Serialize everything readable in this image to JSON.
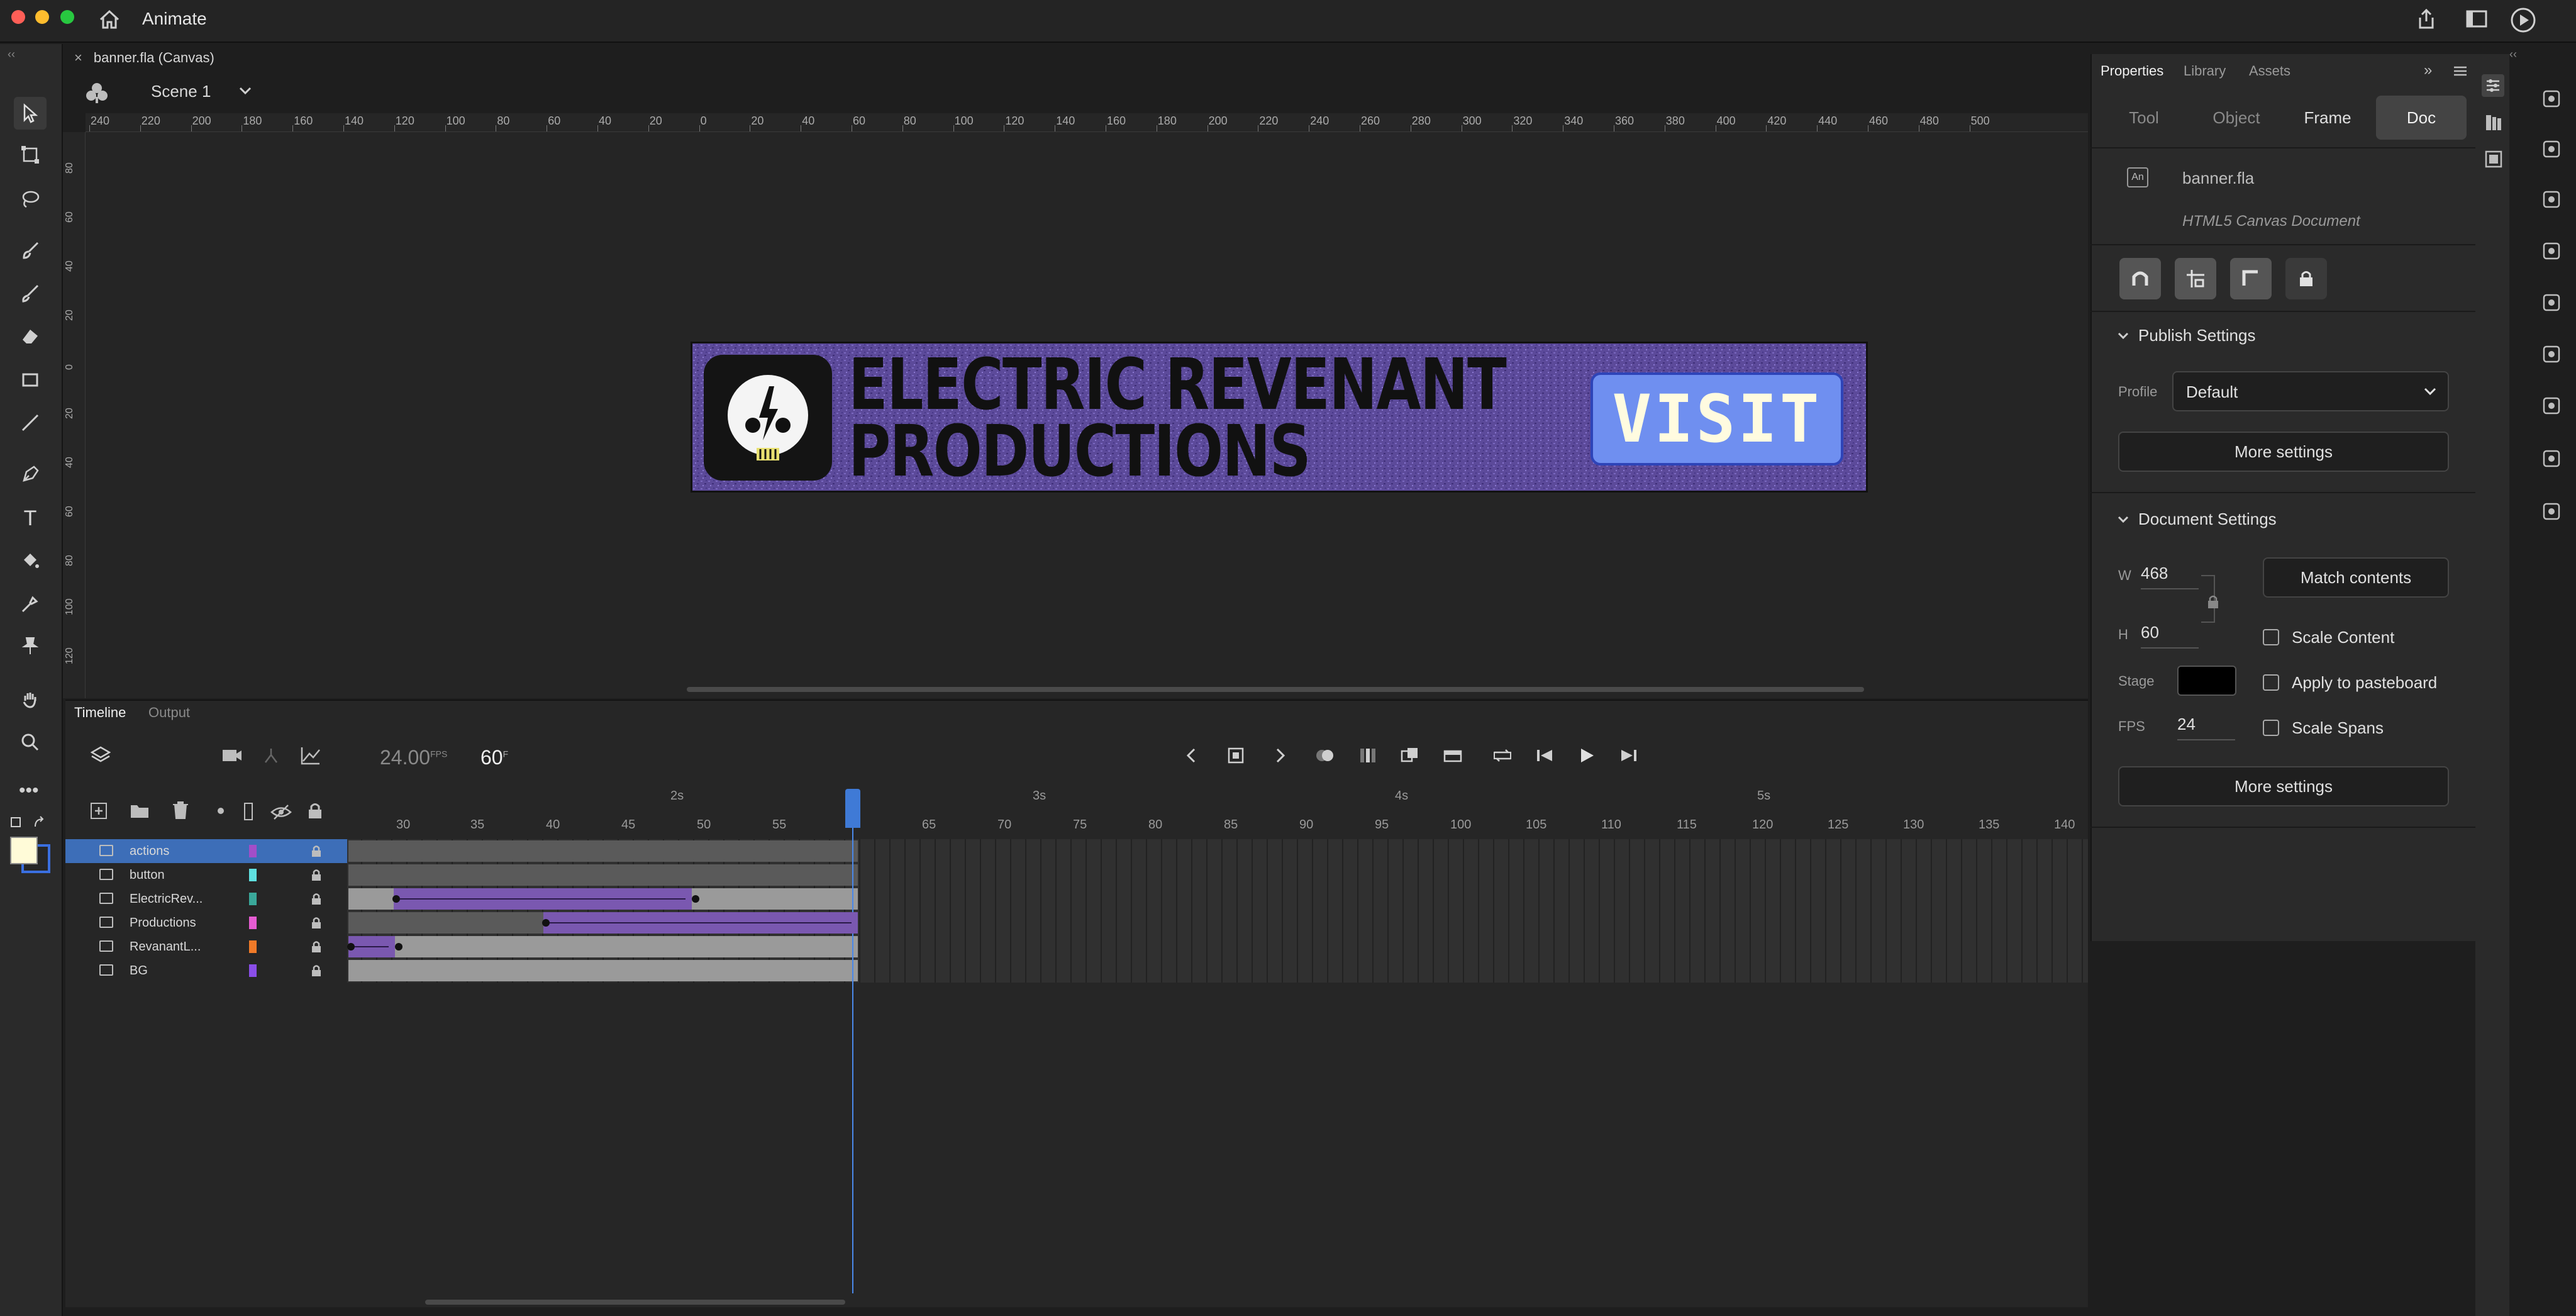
{
  "app": {
    "name": "Animate"
  },
  "document": {
    "tab_title": "banner.fla (Canvas)",
    "scene": "Scene 1"
  },
  "rulers": {
    "horizontal": [
      "240",
      "220",
      "200",
      "180",
      "160",
      "140",
      "120",
      "100",
      "80",
      "60",
      "40",
      "20",
      "0",
      "20",
      "40",
      "60",
      "80",
      "100",
      "120",
      "140",
      "160",
      "180",
      "200",
      "220",
      "240",
      "260",
      "280",
      "300",
      "320",
      "340",
      "360",
      "380",
      "400",
      "420",
      "440",
      "460",
      "480",
      "500"
    ],
    "vertical": [
      "80",
      "60",
      "40",
      "20",
      "0",
      "20",
      "40",
      "60",
      "80",
      "100",
      "120"
    ]
  },
  "stage": {
    "banner_line1": "ELECTRIC REVENANT",
    "banner_line2": "PRODUCTIONS",
    "visit_button": "VISIT",
    "colors": {
      "banner_bg": "#5c4a9a",
      "visit_bg": "#6f8ff0",
      "visit_text": "#fffbe0"
    }
  },
  "timeline": {
    "tabs": [
      "Timeline",
      "Output"
    ],
    "fps_value": "24.00",
    "fps_unit": "FPS",
    "current_frame": "60",
    "frame_unit": "F",
    "seconds": [
      "2s",
      "3s",
      "4s",
      "5s"
    ],
    "frame_numbers": [
      "30",
      "35",
      "40",
      "45",
      "50",
      "55",
      "65",
      "70",
      "75",
      "80",
      "85",
      "90",
      "95",
      "100",
      "105",
      "110",
      "115",
      "120",
      "125",
      "130",
      "135",
      "140"
    ],
    "layers": [
      {
        "name": "actions",
        "color": "#a24ec8",
        "selected": true
      },
      {
        "name": "button",
        "color": "#5fe0e0",
        "selected": false
      },
      {
        "name": "ElectricRev...",
        "color": "#3aa89a",
        "selected": false
      },
      {
        "name": "Productions",
        "color": "#e65cd2",
        "selected": false
      },
      {
        "name": "RevanantL...",
        "color": "#f07a28",
        "selected": false
      },
      {
        "name": "BG",
        "color": "#8a4ee8",
        "selected": false
      }
    ]
  },
  "properties": {
    "tabs": [
      "Properties",
      "Library",
      "Assets"
    ],
    "modes": [
      "Tool",
      "Object",
      "Frame",
      "Doc"
    ],
    "active_mode": "Doc",
    "doc_name": "banner.fla",
    "doc_type": "HTML5 Canvas Document",
    "publish_settings": {
      "title": "Publish Settings",
      "profile_label": "Profile",
      "profile_value": "Default",
      "more_settings": "More settings"
    },
    "document_settings": {
      "title": "Document Settings",
      "w_label": "W",
      "w_value": "468",
      "h_label": "H",
      "h_value": "60",
      "match_contents": "Match contents",
      "scale_content": "Scale Content",
      "stage_label": "Stage",
      "stage_color": "#000000",
      "apply_pasteboard": "Apply to pasteboard",
      "fps_label": "FPS",
      "fps_value": "24",
      "scale_spans": "Scale Spans",
      "more_settings": "More settings"
    }
  }
}
